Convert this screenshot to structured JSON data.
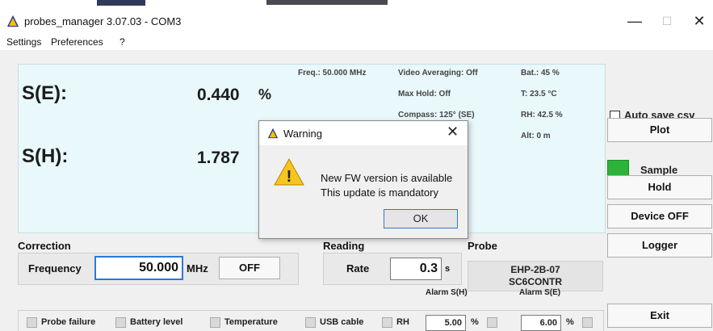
{
  "window": {
    "title": "probes_manager 3.07.03 - COM3",
    "min_glyph": "—",
    "max_glyph": "☐",
    "close_glyph": "✕"
  },
  "menu": [
    "Settings",
    "Preferences",
    "?"
  ],
  "display": {
    "e_label": "S(E):",
    "e_value": "0.440",
    "e_unit": "%",
    "h_label": "S(H):",
    "h_value": "1.787",
    "freq": "Freq.: 50.000 MHz",
    "video_avg": "Video Averaging: Off",
    "max_hold": "Max Hold: Off",
    "compass": "Compass: 125° (SE)",
    "battery": "Bat.: 45 %",
    "temperature": "T: 23.5 °C",
    "humidity": "RH: 42.5 %",
    "altitude": "Alt: 0 m"
  },
  "side": {
    "auto_save": "Auto save csv",
    "plot": "Plot",
    "sample": "Sample",
    "hold": "Hold",
    "device_off": "Device OFF",
    "logger": "Logger",
    "exit": "Exit",
    "sample_color": "#2db33a"
  },
  "correction": {
    "title": "Correction",
    "freq_label": "Frequency",
    "freq_value": "50.000",
    "freq_unit": "MHz",
    "off_button": "OFF"
  },
  "reading": {
    "title": "Reading",
    "rate_label": "Rate",
    "rate_value": "0.3",
    "rate_unit": "s"
  },
  "probe": {
    "title": "Probe",
    "model": "EHP-2B-07",
    "serial": "SC6CONTR"
  },
  "alarms": {
    "h_label": "Alarm S(H)",
    "e_label": "Alarm S(E)",
    "h_value": "5.00",
    "e_value": "6.00",
    "unit": "%"
  },
  "status": {
    "probe_failure": "Probe failure",
    "battery_level": "Battery level",
    "temperature": "Temperature",
    "usb_cable": "USB cable",
    "rh": "RH"
  },
  "dialog": {
    "title": "Warning",
    "line1": "New FW version is available",
    "line2": "This update is mandatory",
    "ok": "OK",
    "close_glyph": "✕",
    "warn_glyph": "!"
  }
}
